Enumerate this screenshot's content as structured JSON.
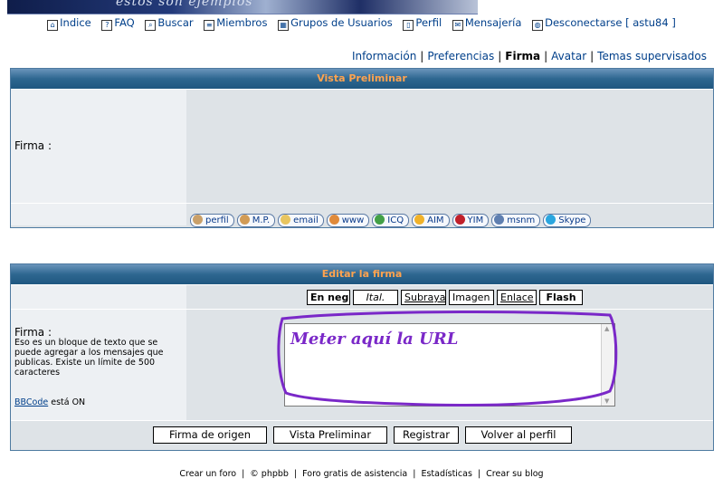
{
  "header": {
    "banner_text": "estos son ejemplos"
  },
  "topnav": [
    {
      "label": "Indice",
      "icon": "home-icon",
      "glyph": "⌂"
    },
    {
      "label": "FAQ",
      "icon": "help-icon",
      "glyph": "?"
    },
    {
      "label": "Buscar",
      "icon": "search-icon",
      "glyph": "⌕"
    },
    {
      "label": "Miembros",
      "icon": "members-icon",
      "glyph": "≡"
    },
    {
      "label": "Grupos de Usuarios",
      "icon": "groups-icon",
      "glyph": "▦"
    },
    {
      "label": "Perfil",
      "icon": "profile-icon",
      "glyph": "▯"
    },
    {
      "label": "Mensajería",
      "icon": "messages-icon",
      "glyph": "✉"
    },
    {
      "label": "Desconectarse [ astu84 ]",
      "icon": "logout-icon",
      "glyph": "◍"
    }
  ],
  "subnav": {
    "items": [
      "Información",
      "Preferencias",
      "Firma",
      "Avatar",
      "Temas supervisados"
    ],
    "current": "Firma",
    "sep": "|"
  },
  "preview": {
    "title": "Vista Preliminar",
    "label": "Firma :",
    "buttons": [
      {
        "label": "perfil",
        "icon": "profile-button-icon",
        "color": "#c9a06a"
      },
      {
        "label": "M.P.",
        "icon": "pm-button-icon",
        "color": "#d19b55"
      },
      {
        "label": "email",
        "icon": "email-button-icon",
        "color": "#e8c560"
      },
      {
        "label": "www",
        "icon": "www-button-icon",
        "color": "#e08a3a"
      },
      {
        "label": "ICQ",
        "icon": "icq-button-icon",
        "color": "#43a047"
      },
      {
        "label": "AIM",
        "icon": "aim-button-icon",
        "color": "#f0b22a"
      },
      {
        "label": "YIM",
        "icon": "yim-button-icon",
        "color": "#c0202a"
      },
      {
        "label": "msnm",
        "icon": "msnm-button-icon",
        "color": "#5f7fb0"
      },
      {
        "label": "Skype",
        "icon": "skype-button-icon",
        "color": "#2aa6df"
      }
    ]
  },
  "edit": {
    "title": "Editar la firma",
    "bbcode_buttons": [
      {
        "label": "En neg",
        "style": "bold"
      },
      {
        "label": "Ital.",
        "style": "italic"
      },
      {
        "label": "Subraya",
        "style": "underline"
      },
      {
        "label": "Imagen",
        "style": "normal"
      },
      {
        "label": "Enlace",
        "style": "underline"
      },
      {
        "label": "Flash",
        "style": "bold"
      }
    ],
    "label": "Firma :",
    "help": "Eso es un bloque de texto que se puede agregar a los mensajes que publicas. Existe un límite de 500 caracteres",
    "bbcode_link": "BBCode",
    "bbcode_status": " está ON",
    "textarea_value": "Meter aquí la URL",
    "annotation_color": "#7a28c8",
    "actions": [
      "Firma de origen",
      "Vista Preliminar",
      "Registrar",
      "Volver al perfil"
    ]
  },
  "footer": {
    "items": [
      "Crear un foro",
      "© phpbb",
      "Foro gratis de asistencia",
      "Estadísticas",
      "Crear su blog"
    ],
    "sep": "|"
  },
  "colors": {
    "header_text": "#ffa34f",
    "header_bg": "#2e6790",
    "link": "#003f8a",
    "row_bg": "#dee3e7",
    "row_bg_light": "#edf0f3"
  }
}
